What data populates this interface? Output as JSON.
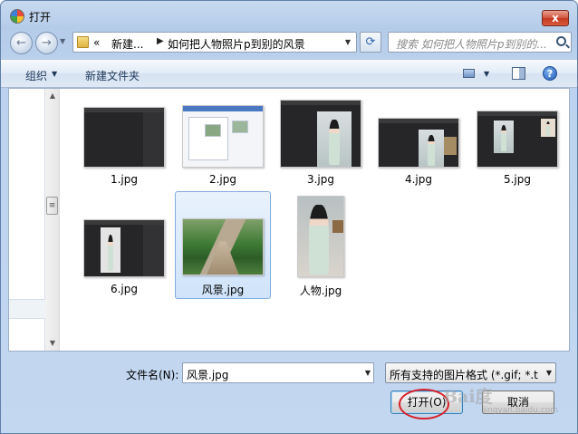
{
  "window": {
    "title": "打开",
    "close_label": "x"
  },
  "nav": {
    "back_icon": "←",
    "forward_icon": "→",
    "address_prefix": "«",
    "address_parent": "新建...",
    "address_separator": "▶",
    "address_current": "如何把人物照片p到别的风景",
    "refresh_icon": "⟳",
    "search_placeholder": "搜索 如何把人物照片p到别的..."
  },
  "toolbar": {
    "organize_label": "组织",
    "new_folder_label": "新建文件夹",
    "help_label": "?"
  },
  "files": [
    {
      "name": "1.jpg",
      "kind": "dark-screenshot"
    },
    {
      "name": "2.jpg",
      "kind": "white-screenshot"
    },
    {
      "name": "3.jpg",
      "kind": "dark-person"
    },
    {
      "name": "4.jpg",
      "kind": "dark-person"
    },
    {
      "name": "5.jpg",
      "kind": "dark-person"
    },
    {
      "name": "6.jpg",
      "kind": "dark-person"
    },
    {
      "name": "风景.jpg",
      "kind": "landscape",
      "selected": true
    },
    {
      "name": "人物.jpg",
      "kind": "portrait"
    }
  ],
  "bottom": {
    "filename_label": "文件名(N):",
    "filename_value": "风景.jpg",
    "filter_value": "所有支持的图片格式 (*.gif; *.tif",
    "open_button": "打开(O)",
    "cancel_button": "取消"
  },
  "watermark": {
    "main": "Bai度",
    "sub": "jingyan.baidu.com"
  },
  "colors": {
    "annotation_red": "#d8202a",
    "selection_blue": "#cfe3fa"
  }
}
